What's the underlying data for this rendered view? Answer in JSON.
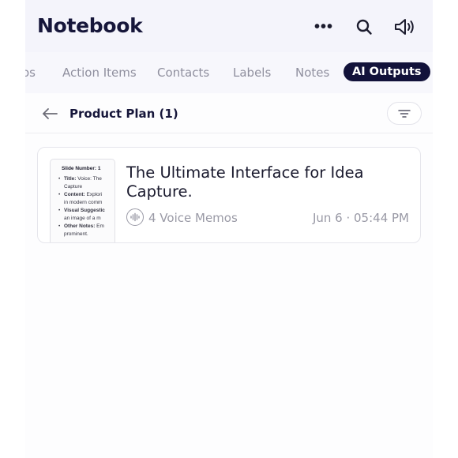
{
  "header": {
    "title": "Notebook",
    "more_glyph": "•••",
    "icons": [
      "more-icon",
      "search-icon",
      "speaker-icon"
    ]
  },
  "tabs": [
    {
      "label": "os",
      "active": false
    },
    {
      "label": "Action Items",
      "active": false
    },
    {
      "label": "Contacts",
      "active": false
    },
    {
      "label": "Labels",
      "active": false
    },
    {
      "label": "Notes",
      "active": false
    },
    {
      "label": "AI Outputs",
      "active": true
    }
  ],
  "subbar": {
    "title": "Product Plan (1)"
  },
  "card": {
    "thumbnail": {
      "heading": "Slide Number: 1",
      "items": [
        {
          "bold": "Title:",
          "text": " Voice: The"
        },
        {
          "bold": "",
          "text": "Capture",
          "cont": true
        },
        {
          "bold": "Content:",
          "text": " Explori"
        },
        {
          "bold": "",
          "text": "in modern comm",
          "cont": true
        },
        {
          "bold": "Visual Suggestic",
          "text": ""
        },
        {
          "bold": "",
          "text": "an image of a m",
          "cont": true
        },
        {
          "bold": "Other Notes:",
          "text": " Em"
        },
        {
          "bold": "",
          "text": "prominent.",
          "cont": true
        }
      ]
    },
    "title": "The Ultimate Interface for Idea Capture.",
    "memo_count": "4 Voice Memos",
    "date": "Jun 6 · 05:44 PM"
  },
  "colors": {
    "header_bg": "#f4f4fb",
    "active_tab_bg": "#12123a",
    "text_dark": "#16163a",
    "text_muted": "#8f8f9e"
  }
}
